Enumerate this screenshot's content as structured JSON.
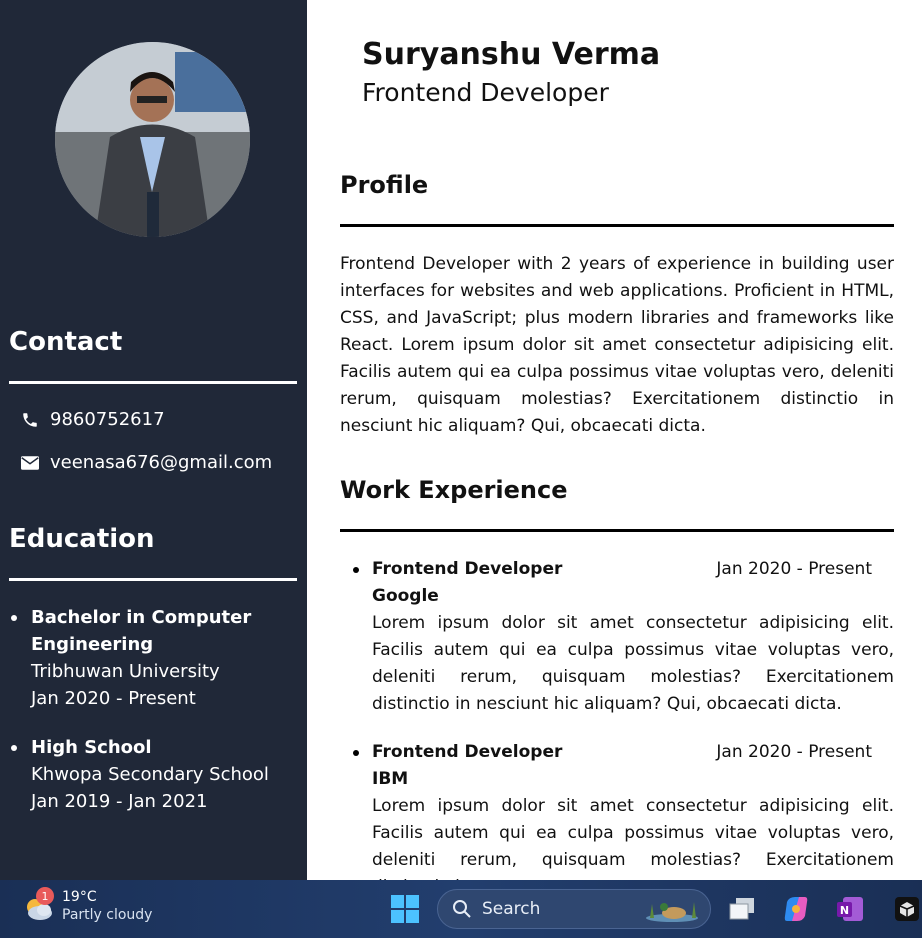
{
  "profile_photo_alt": "profile photo",
  "header": {
    "name": "Suryanshu Verma",
    "role": "Frontend Developer"
  },
  "sidebar": {
    "contact_title": "Contact",
    "phone": "9860752617",
    "email": "veenasa676@gmail.com",
    "education_title": "Education",
    "education": [
      {
        "degree": "Bachelor in Computer Engineering",
        "school": "Tribhuwan University",
        "period": "Jan 2020 - Present"
      },
      {
        "degree": "High School",
        "school": "Khwopa Secondary School",
        "period": "Jan 2019 - Jan 2021"
      }
    ]
  },
  "profile": {
    "title": "Profile",
    "text": "Frontend Developer with 2 years of experience in building user interfaces for websites and web applications. Proficient in HTML, CSS, and JavaScript; plus modern libraries and frameworks like React. Lorem ipsum dolor sit amet consectetur adipisicing elit. Facilis autem qui ea culpa possimus vitae voluptas vero, deleniti rerum, quisquam molestias? Exercitationem distinctio in nesciunt hic aliquam? Qui, obcaecati dicta."
  },
  "experience": {
    "title": "Work Experience",
    "jobs": [
      {
        "title": "Frontend Developer",
        "period": "Jan 2020 - Present",
        "company": "Google",
        "desc": "Lorem ipsum dolor sit amet consectetur adipisicing elit. Facilis autem qui ea culpa possimus vitae voluptas vero, deleniti rerum, quisquam molestias? Exercitationem distinctio in nesciunt hic aliquam? Qui, obcaecati dicta."
      },
      {
        "title": "Frontend Developer",
        "period": "Jan 2020 - Present",
        "company": "IBM",
        "desc": "Lorem ipsum dolor sit amet consectetur adipisicing elit. Facilis autem qui ea culpa possimus vitae voluptas vero, deleniti rerum, quisquam molestias? Exercitationem distinctio in"
      }
    ]
  },
  "taskbar": {
    "weather_badge": "1",
    "temperature": "19°C",
    "weather_desc": "Partly cloudy",
    "search_label": "Search"
  },
  "colors": {
    "sidebar_bg": "#202838",
    "taskbar_bg": "#1d3557",
    "accent_blue": "#2e8bf0"
  }
}
